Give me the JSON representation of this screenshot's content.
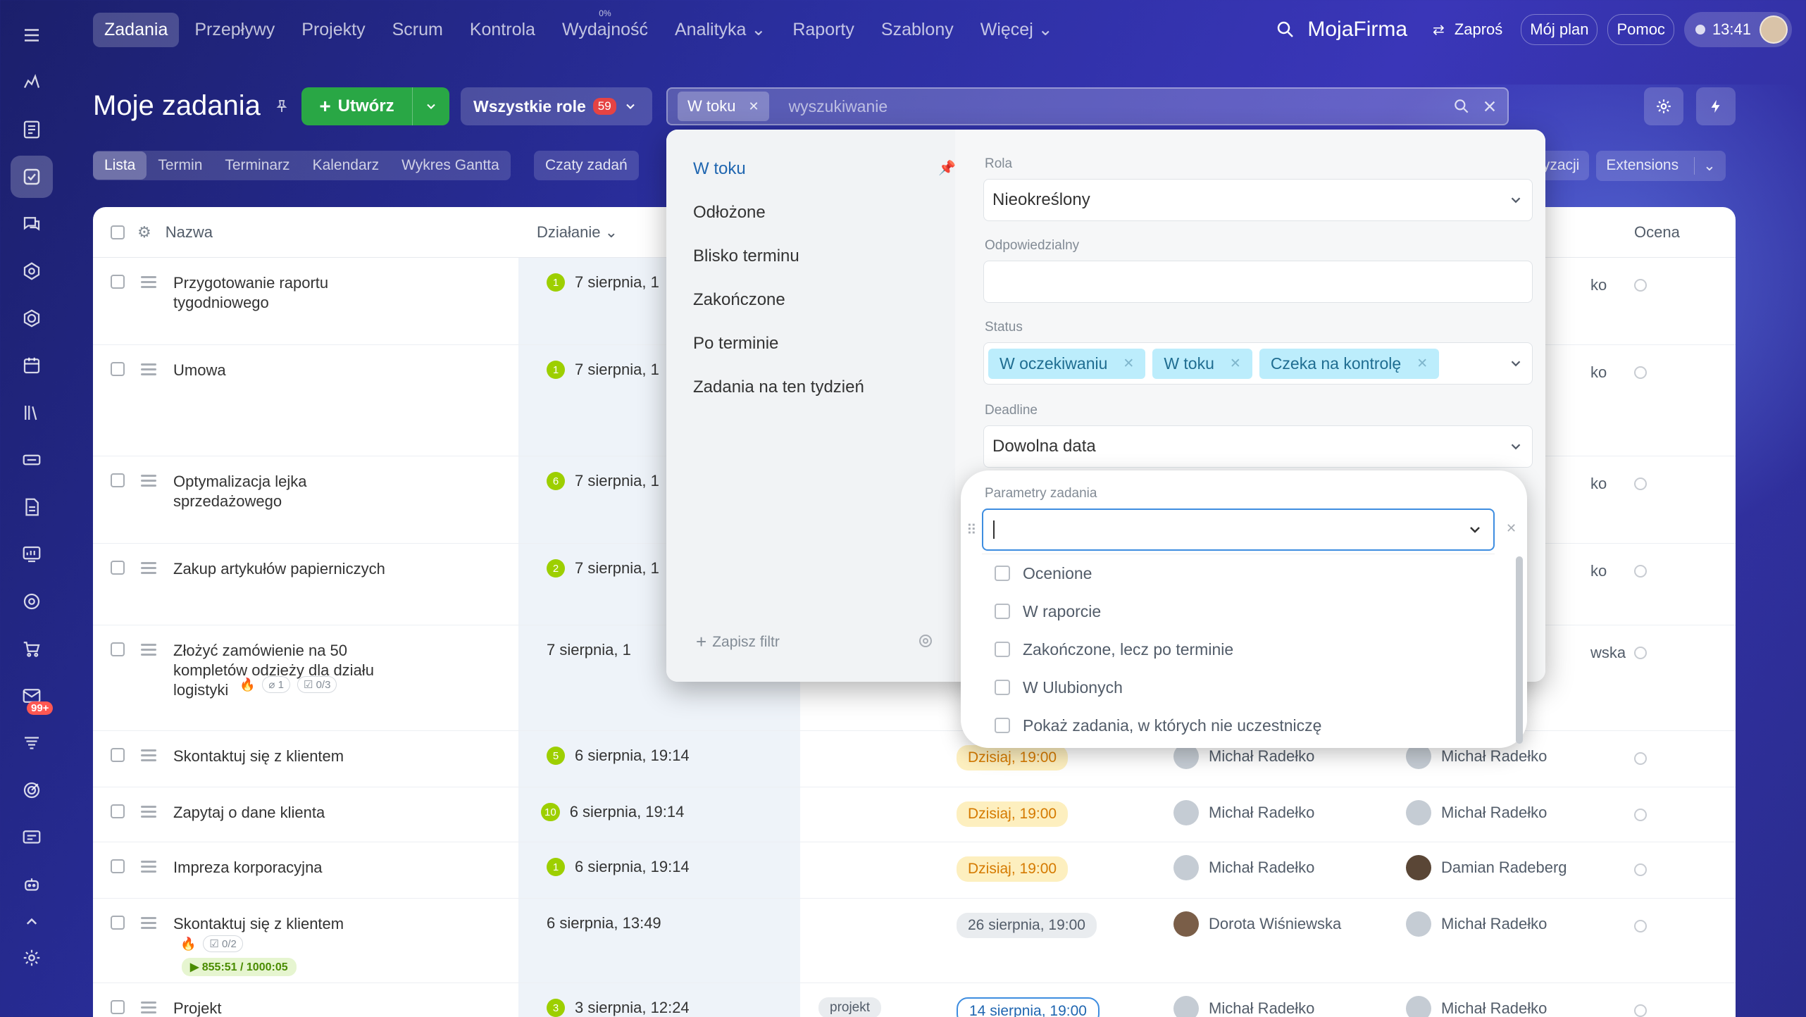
{
  "nav": {
    "items": [
      {
        "label": "Zadania",
        "sup": ""
      },
      {
        "label": "Przepływy",
        "sup": ""
      },
      {
        "label": "Projekty",
        "sup": ""
      },
      {
        "label": "Scrum",
        "sup": ""
      },
      {
        "label": "Kontrola",
        "sup": ""
      },
      {
        "label": "Wydajność",
        "sup": "0%"
      },
      {
        "label": "Analityka ⌄",
        "sup": ""
      },
      {
        "label": "Raporty",
        "sup": ""
      },
      {
        "label": "Szablony",
        "sup": ""
      },
      {
        "label": "Więcej ⌄",
        "sup": ""
      }
    ],
    "company": "MojaFirma",
    "invite": "Zaproś",
    "my_plan": "Mój plan",
    "help": "Pomoc",
    "time": "13:41"
  },
  "rail": {
    "icons": [
      "hamburger-icon",
      "feed-icon",
      "news-icon",
      "tasks-icon",
      "chat-icon",
      "crm-icon",
      "sites-icon",
      "calendar-icon",
      "library-icon",
      "inventory-icon",
      "documents-icon",
      "analytics-icon",
      "automation-icon",
      "shop-icon",
      "mail-icon",
      "filter-icon",
      "target-icon",
      "contact-center-icon",
      "robot-icon",
      "collapse-icon",
      "settings-icon"
    ],
    "mail_badge": "99+"
  },
  "header": {
    "title": "Moje zadania",
    "create_label": "Utwórz",
    "roles_label": "Wszystkie role",
    "roles_count": "59",
    "search_chip": "W toku",
    "search_placeholder": "wyszukiwanie"
  },
  "view_tabs": [
    "Lista",
    "Termin",
    "Terminarz",
    "Kalendarz",
    "Wykres Gantta"
  ],
  "chat_tab": "Czaty zadań",
  "right_tabs": {
    "partial": "tyzacji",
    "extensions": "Extensions"
  },
  "table": {
    "headers": {
      "name": "Nazwa",
      "activity": "Działanie ⌄",
      "rating": "Ocena"
    },
    "rows": [
      {
        "name": "Przygotowanie raportu tygodniowego",
        "count": "1",
        "activity": "7 sierpnia, 1",
        "deadline": "",
        "creator": "",
        "owner": "ko"
      },
      {
        "name": "Umowa",
        "count": "1",
        "activity": "7 sierpnia, 1",
        "deadline": "",
        "creator": "",
        "owner": "ko"
      },
      {
        "name": "Optymalizacja lejka sprzedażowego",
        "count": "6",
        "activity": "7 sierpnia, 1",
        "deadline": "",
        "creator": "",
        "owner": "ko"
      },
      {
        "name": "Zakup artykułów papierniczych",
        "count": "2",
        "activity": "7 sierpnia, 1",
        "deadline": "",
        "creator": "",
        "owner": "ko"
      },
      {
        "name": "Złożyć zamówienie na 50 kompletów odzieży dla działu logistyki",
        "count": "",
        "activity": "7 sierpnia, 1",
        "deadline": "",
        "creator": "",
        "owner": "wska",
        "meta_files": "1",
        "meta_check": "0/3"
      },
      {
        "name": "Skontaktuj się z klientem",
        "count": "5",
        "activity": "6 sierpnia, 19:14",
        "deadline": "Dzisiaj, 19:00",
        "creator": "Michał Radełko",
        "owner": "Michał Radełko"
      },
      {
        "name": "Zapytaj o dane klienta",
        "count": "10",
        "activity": "6 sierpnia, 19:14",
        "deadline": "Dzisiaj, 19:00",
        "creator": "Michał Radełko",
        "owner": "Michał Radełko"
      },
      {
        "name": "Impreza korporacyjna",
        "count": "1",
        "activity": "6 sierpnia, 19:14",
        "deadline": "Dzisiaj, 19:00",
        "creator": "Michał Radełko",
        "owner": "Damian Radeberg"
      },
      {
        "name": "Skontaktuj się z klientem",
        "count": "",
        "activity": "6 sierpnia, 13:49",
        "deadline": "26 sierpnia, 19:00",
        "creator": "Dorota Wiśniewska",
        "owner": "Michał Radełko",
        "meta_check": "0/2",
        "timer": "855:51 / 1000:05"
      },
      {
        "name": "Projekt",
        "count": "3",
        "activity": "3 sierpnia, 12:24",
        "deadline": "14 sierpnia, 19:00",
        "creator": "Michał Radełko",
        "owner": "Michał Radełko",
        "project": "projekt"
      }
    ]
  },
  "filter": {
    "presets": [
      "W toku",
      "Odłożone",
      "Blisko terminu",
      "Zakończone",
      "Po terminie",
      "Zadania na ten tydzień"
    ],
    "save_filter": "Zapisz filtr",
    "fields": {
      "role_label": "Rola",
      "role_value": "Nieokreślony",
      "responsible_label": "Odpowiedzialny",
      "responsible_value": "",
      "status_label": "Status",
      "status_tags": [
        "W oczekiwaniu",
        "W toku",
        "Czeka na kontrolę"
      ],
      "deadline_label": "Deadline",
      "deadline_value": "Dowolna data"
    },
    "params": {
      "label": "Parametry zadania",
      "options": [
        "Ocenione",
        "W raporcie",
        "Zakończone, lecz po terminie",
        "W Ulubionych",
        "Pokaż zadania, w których nie uczestniczę"
      ]
    }
  },
  "colors": {
    "accent": "#3e8de0",
    "create": "#29a745",
    "activity_badge": "#9dcf00",
    "deadline_today_bg": "#fdefbf",
    "tag_bg": "#bcedfc"
  }
}
